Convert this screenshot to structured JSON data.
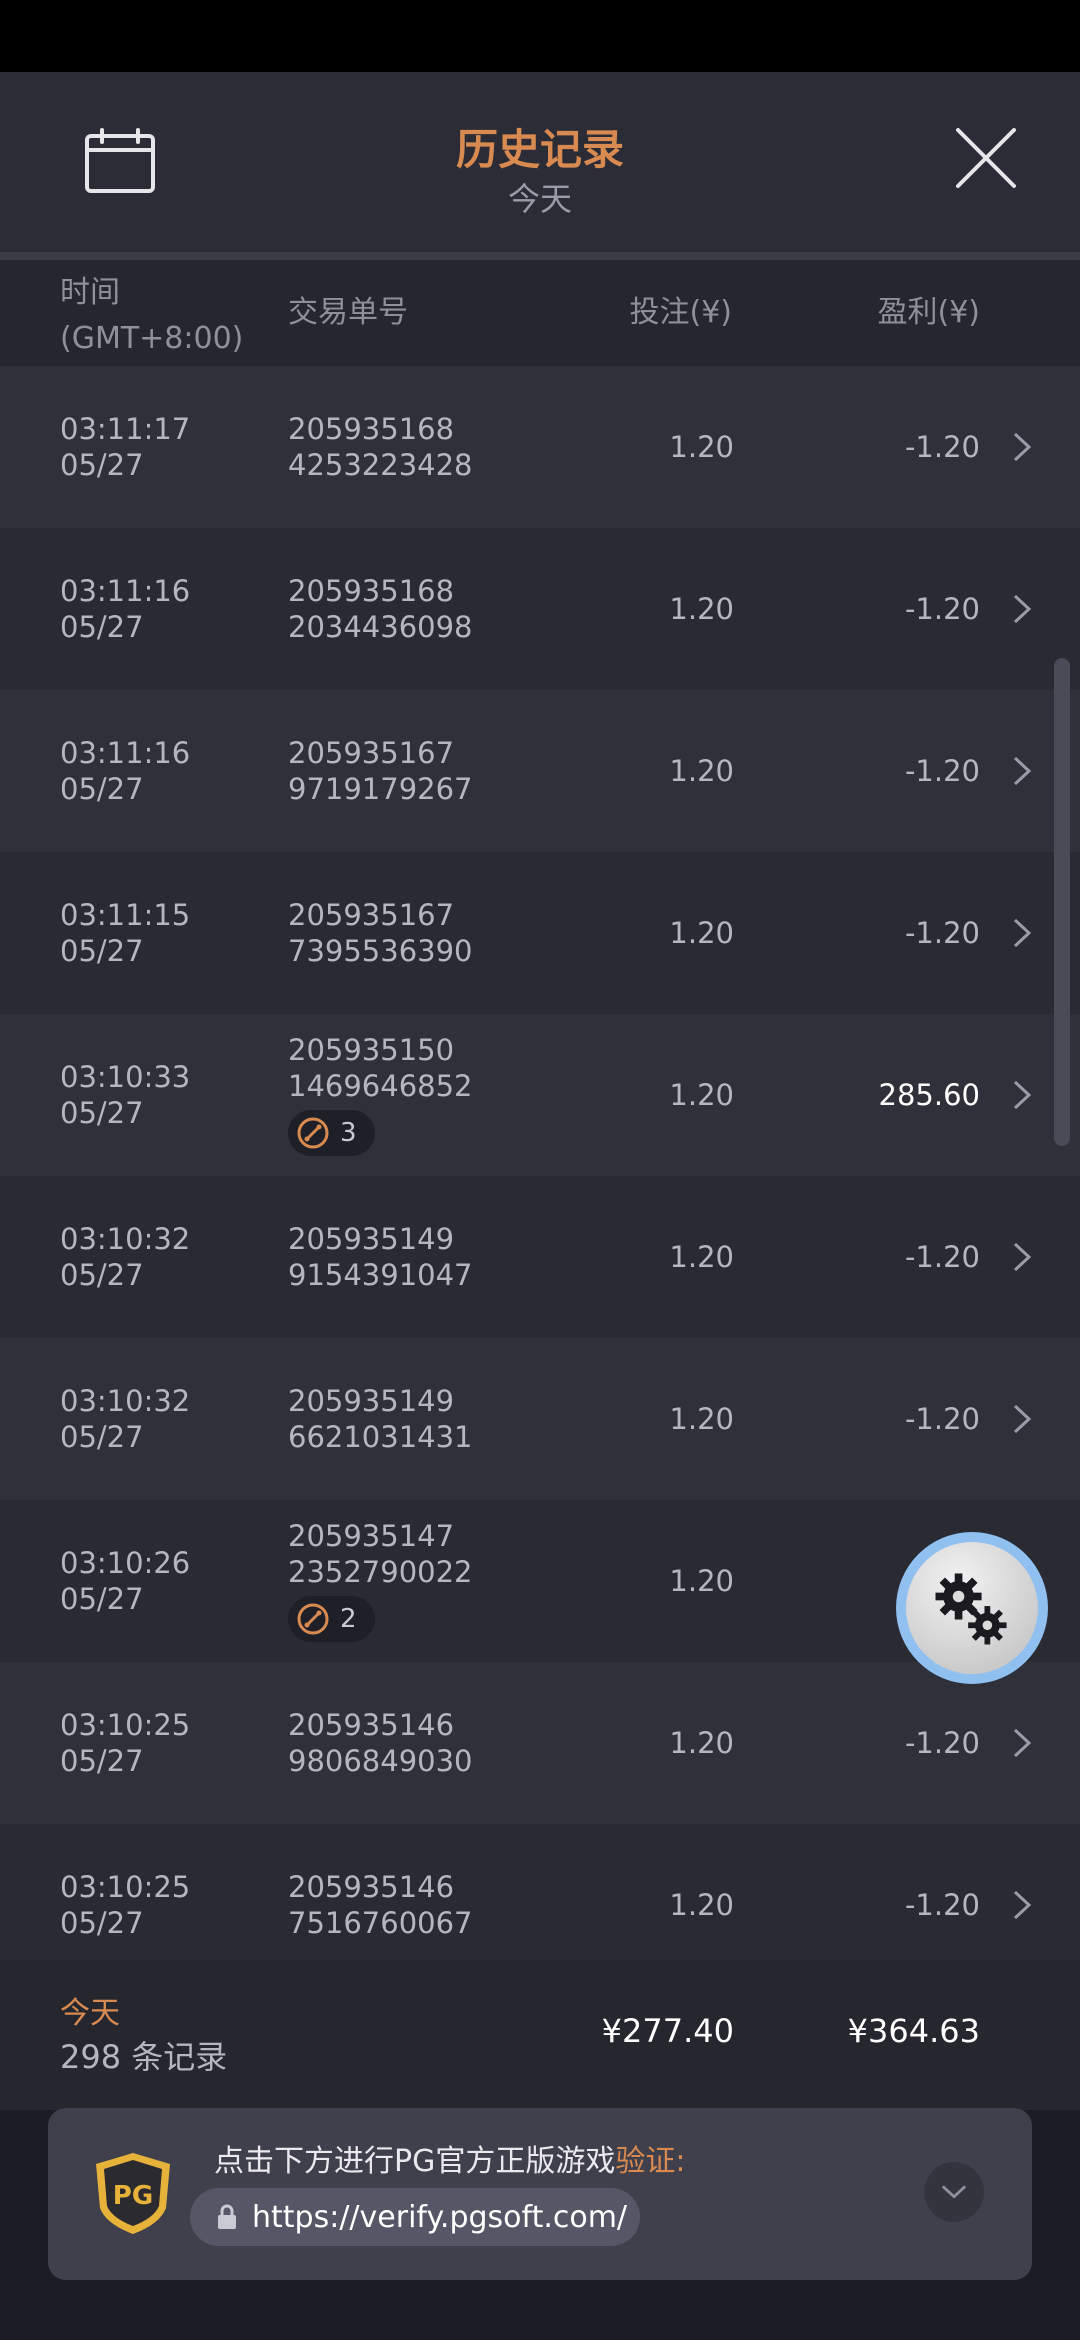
{
  "header": {
    "title": "历史记录",
    "subtitle": "今天",
    "calendar_icon": "calendar-icon",
    "close_icon": "close-icon",
    "accent_color": "#d88a51"
  },
  "columns": {
    "time_line1": "时间",
    "time_line2": "(GMT+8:00)",
    "order": "交易单号",
    "bet": "投注(¥)",
    "profit": "盈利(¥)"
  },
  "rows": [
    {
      "time": "03:11:17",
      "date": "05/27",
      "order1": "205935168",
      "order2": "4253223428",
      "bet": "1.20",
      "profit": "-1.20",
      "badge": ""
    },
    {
      "time": "03:11:16",
      "date": "05/27",
      "order1": "205935168",
      "order2": "2034436098",
      "bet": "1.20",
      "profit": "-1.20",
      "badge": ""
    },
    {
      "time": "03:11:16",
      "date": "05/27",
      "order1": "205935167",
      "order2": "9719179267",
      "bet": "1.20",
      "profit": "-1.20",
      "badge": ""
    },
    {
      "time": "03:11:15",
      "date": "05/27",
      "order1": "205935167",
      "order2": "7395536390",
      "bet": "1.20",
      "profit": "-1.20",
      "badge": ""
    },
    {
      "time": "03:10:33",
      "date": "05/27",
      "order1": "205935150",
      "order2": "1469646852",
      "bet": "1.20",
      "profit": "285.60",
      "badge": "3"
    },
    {
      "time": "03:10:32",
      "date": "05/27",
      "order1": "205935149",
      "order2": "9154391047",
      "bet": "1.20",
      "profit": "-1.20",
      "badge": ""
    },
    {
      "time": "03:10:32",
      "date": "05/27",
      "order1": "205935149",
      "order2": "6621031431",
      "bet": "1.20",
      "profit": "-1.20",
      "badge": ""
    },
    {
      "time": "03:10:26",
      "date": "05/27",
      "order1": "205935147",
      "order2": "2352790022",
      "bet": "1.20",
      "profit": "",
      "badge": "2"
    },
    {
      "time": "03:10:25",
      "date": "05/27",
      "order1": "205935146",
      "order2": "9806849030",
      "bet": "1.20",
      "profit": "-1.20",
      "badge": ""
    },
    {
      "time": "03:10:25",
      "date": "05/27",
      "order1": "205935146",
      "order2": "7516760067",
      "bet": "1.20",
      "profit": "-1.20",
      "badge": ""
    }
  ],
  "summary": {
    "label": "今天",
    "count": "298 条记录",
    "total_bet": "¥277.40",
    "total_profit": "¥364.63"
  },
  "verify": {
    "text": "点击下方进行PG官方正版游戏",
    "accent_text": "验证:",
    "url": "https://verify.pgsoft.com/",
    "logo_text": "PG"
  }
}
